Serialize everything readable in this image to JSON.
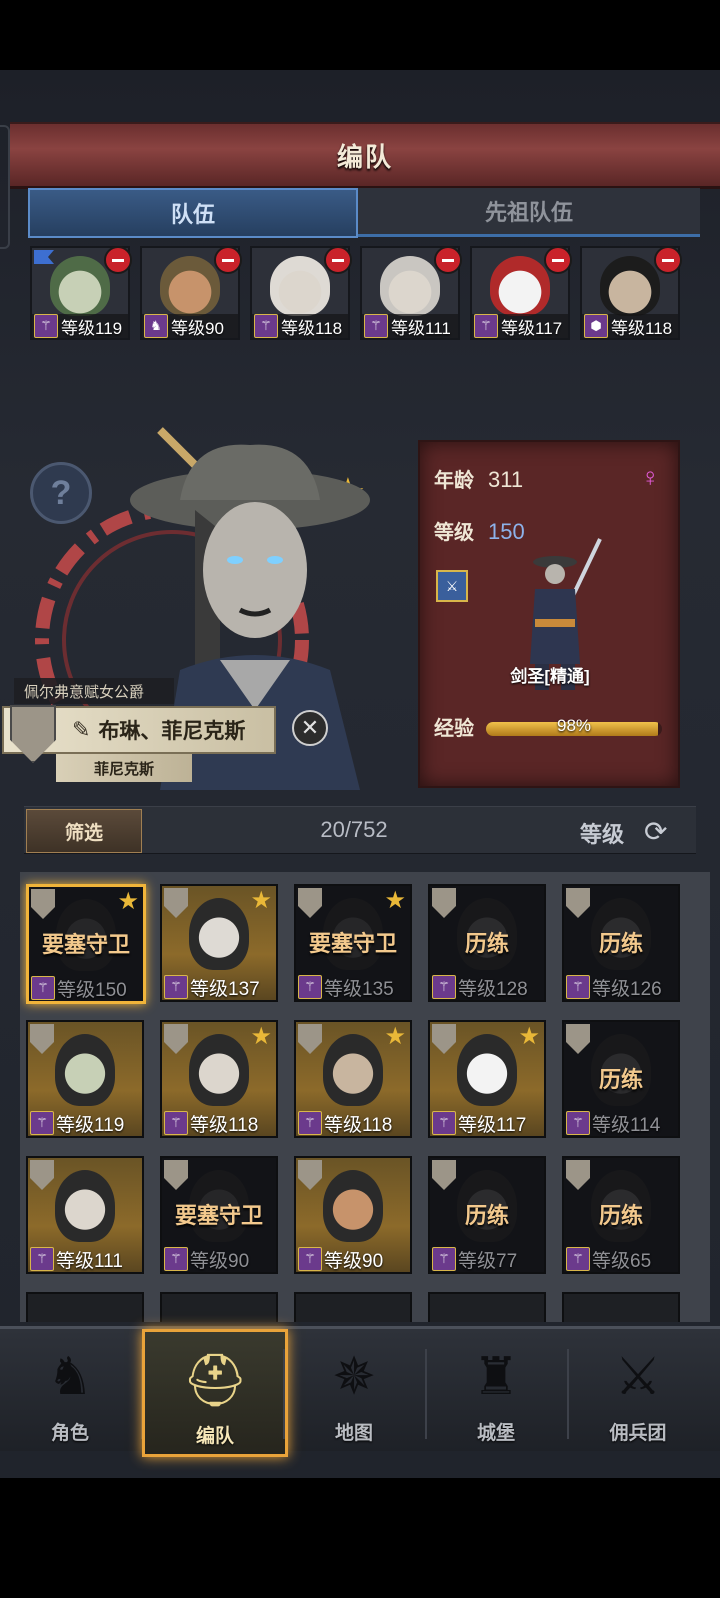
{
  "title": "编队",
  "tabs": {
    "team": "队伍",
    "ancestor": "先祖队伍"
  },
  "team_members": [
    {
      "level": "等级119",
      "skin": "#c7d0b6",
      "hair": "#4f6b47",
      "cls": "magic-wand",
      "flag": true
    },
    {
      "level": "等级90",
      "skin": "#c7936b",
      "hair": "#6b5a3a",
      "cls": "horse",
      "flag": false
    },
    {
      "level": "等级118",
      "skin": "#dcd6cd",
      "hair": "#dedad4",
      "cls": "magic-wand",
      "flag": false
    },
    {
      "level": "等级111",
      "skin": "#dcd6cd",
      "hair": "#c9c6c1",
      "cls": "magic-wand",
      "flag": false
    },
    {
      "level": "等级117",
      "skin": "#f3f3f3",
      "hair": "#b02a2a",
      "cls": "magic-wand",
      "flag": false
    },
    {
      "level": "等级118",
      "skin": "#c8b59f",
      "hair": "#1c1c1c",
      "cls": "shield",
      "flag": false
    }
  ],
  "hero": {
    "title": "佩尔弗意赋女公爵",
    "name": "布琳、菲尼克斯",
    "house": "菲尼克斯",
    "age_label": "年龄",
    "age": "311",
    "level_label": "等级",
    "level": "150",
    "class_name": "剑圣[精通]",
    "exp_label": "经验",
    "exp": "98%",
    "exp_fraction": 0.98
  },
  "filter": {
    "button": "筛选",
    "count": "20/752",
    "sort": "等级"
  },
  "roster": [
    {
      "status": "要塞守卫",
      "level": "等级150",
      "style": "dark",
      "selected": true,
      "star": true,
      "skin": "#4a4a4a"
    },
    {
      "status": "",
      "level": "等级137",
      "style": "gold",
      "selected": false,
      "star": true,
      "skin": "#dedad4"
    },
    {
      "status": "要塞守卫",
      "level": "等级135",
      "style": "dark",
      "selected": false,
      "star": true,
      "skin": "#4a4a4a"
    },
    {
      "status": "历练",
      "level": "等级128",
      "style": "dark",
      "selected": false,
      "star": false,
      "skin": "#555"
    },
    {
      "status": "历练",
      "level": "等级126",
      "style": "dark",
      "selected": false,
      "star": false,
      "skin": "#555"
    },
    {
      "status": "",
      "level": "等级119",
      "style": "gold",
      "selected": false,
      "star": false,
      "skin": "#c7d0b6"
    },
    {
      "status": "",
      "level": "等级118",
      "style": "gold",
      "selected": false,
      "star": true,
      "skin": "#dcd6cd"
    },
    {
      "status": "",
      "level": "等级118",
      "style": "gold",
      "selected": false,
      "star": true,
      "skin": "#c8b59f"
    },
    {
      "status": "",
      "level": "等级117",
      "style": "gold",
      "selected": false,
      "star": true,
      "skin": "#f3f3f3"
    },
    {
      "status": "历练",
      "level": "等级114",
      "style": "dark",
      "selected": false,
      "star": false,
      "skin": "#555"
    },
    {
      "status": "",
      "level": "等级111",
      "style": "gold",
      "selected": false,
      "star": false,
      "skin": "#dcd6cd"
    },
    {
      "status": "要塞守卫",
      "level": "等级90",
      "style": "dark",
      "selected": false,
      "star": false,
      "skin": "#4a4a4a"
    },
    {
      "status": "",
      "level": "等级90",
      "style": "gold",
      "selected": false,
      "star": false,
      "skin": "#c7936b"
    },
    {
      "status": "历练",
      "level": "等级77",
      "style": "dark",
      "selected": false,
      "star": false,
      "skin": "#555"
    },
    {
      "status": "历练",
      "level": "等级65",
      "style": "dark",
      "selected": false,
      "star": false,
      "skin": "#555"
    }
  ],
  "menu": [
    {
      "label": "角色",
      "icon": "knight-icon"
    },
    {
      "label": "编队",
      "icon": "helmet-icon"
    },
    {
      "label": "地图",
      "icon": "compass-icon"
    },
    {
      "label": "城堡",
      "icon": "castle-icon"
    },
    {
      "label": "佣兵团",
      "icon": "mercenary-icon"
    }
  ],
  "colors": {
    "title_bar": "#8a4341",
    "tab_active": "#3a5b86",
    "accent_gold": "#e9b838",
    "info_panel": "#5a2626",
    "level_text": "#8db2ea"
  }
}
